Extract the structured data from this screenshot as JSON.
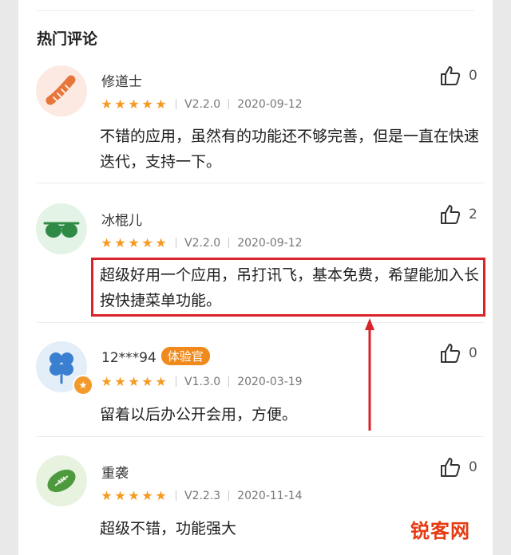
{
  "section_title": "热门评论",
  "comments": [
    {
      "name": "修道士",
      "tag": "",
      "version": "V2.2.0",
      "date": "2020-09-12",
      "likes": "0",
      "text": "不错的应用，虽然有的功能还不够完善，但是一直在快速迭代，支持一下。",
      "rating": 5
    },
    {
      "name": "冰棍儿",
      "tag": "",
      "version": "V2.2.0",
      "date": "2020-09-12",
      "likes": "2",
      "text": "超级好用一个应用，吊打讯飞，基本免费，希望能加入长按快捷菜单功能。",
      "rating": 5
    },
    {
      "name": "12***94",
      "tag": "体验官",
      "version": "V1.3.0",
      "date": "2020-03-19",
      "likes": "0",
      "text": "留着以后办公开会用，方便。",
      "rating": 5
    },
    {
      "name": "重袭",
      "tag": "",
      "version": "V2.2.3",
      "date": "2020-11-14",
      "likes": "0",
      "text": "超级不错，功能强大",
      "rating": 5
    }
  ],
  "watermark": "锐客网",
  "colors": {
    "star": "#f59a23",
    "highlight": "#d9232a",
    "tag": "#f08a1c"
  },
  "icons": [
    "sausage-icon",
    "sunglasses-icon",
    "clover-icon",
    "football-icon",
    "thumb-up-icon",
    "star-badge-icon"
  ]
}
